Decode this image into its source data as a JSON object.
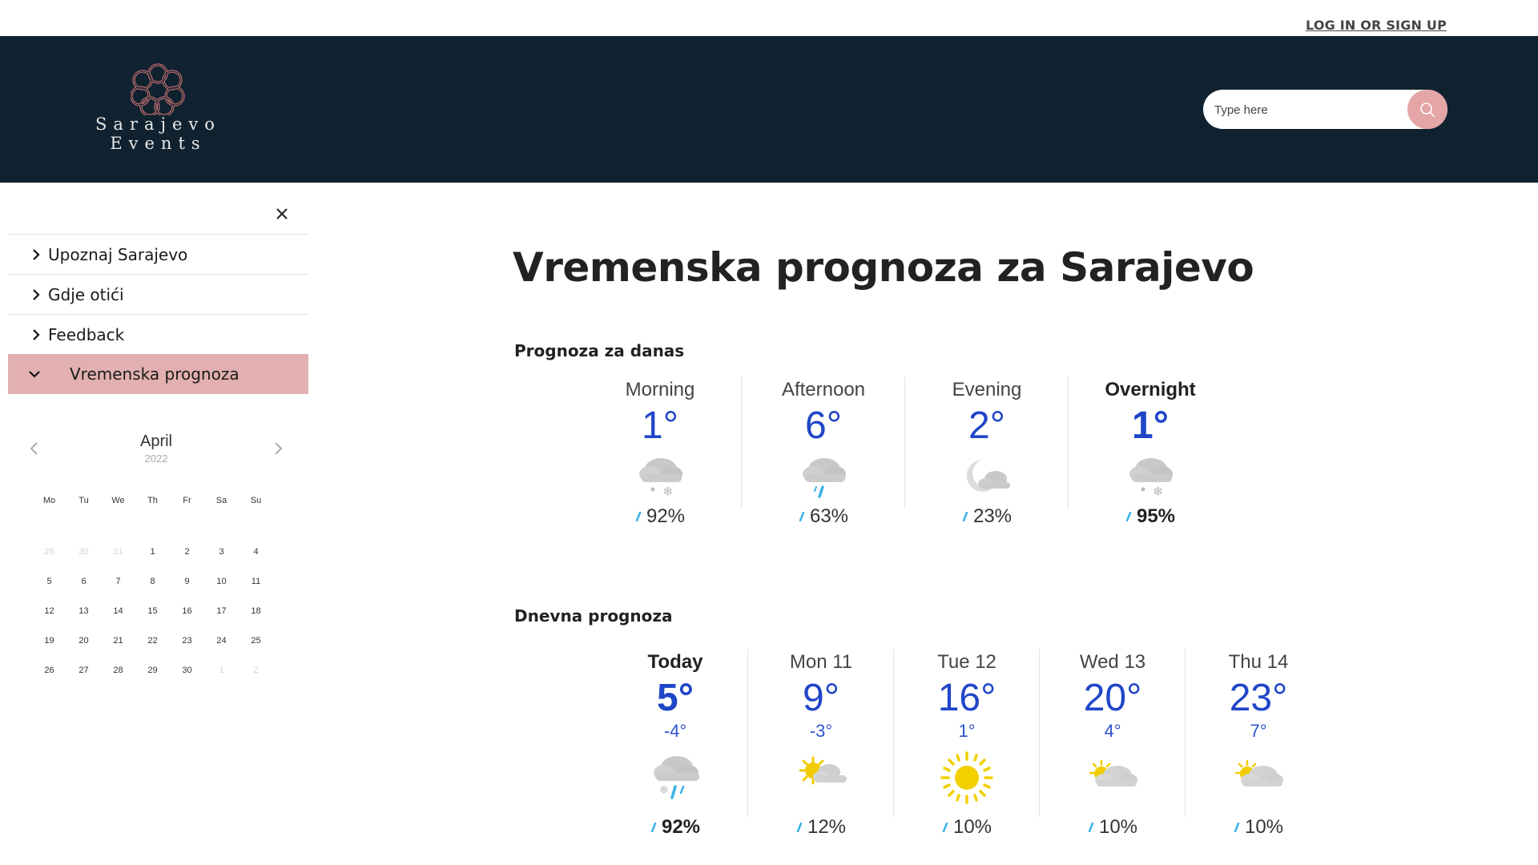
{
  "topbar": {
    "login_label": "LOG IN OR SIGN UP"
  },
  "brand": {
    "line1": "Sarajevo",
    "line2": "Events"
  },
  "search": {
    "placeholder": "Type here"
  },
  "sidebar": {
    "items": [
      {
        "label": "Upoznaj Sarajevo"
      },
      {
        "label": "Gdje otići"
      },
      {
        "label": "Feedback"
      },
      {
        "label": "Vremenska prognoza"
      }
    ]
  },
  "calendar": {
    "month": "April",
    "year": "2022",
    "weekdays": [
      "Mo",
      "Tu",
      "We",
      "Th",
      "Fr",
      "Sa",
      "Su"
    ],
    "weeks": [
      [
        "29",
        "30",
        "31",
        "1",
        "2",
        "3",
        "4"
      ],
      [
        "5",
        "6",
        "7",
        "8",
        "9",
        "10",
        "11"
      ],
      [
        "12",
        "13",
        "14",
        "15",
        "16",
        "17",
        "18"
      ],
      [
        "19",
        "20",
        "21",
        "22",
        "23",
        "24",
        "25"
      ],
      [
        "26",
        "27",
        "28",
        "29",
        "30",
        "1",
        "2"
      ]
    ]
  },
  "main": {
    "title": "Vremenska prognoza za Sarajevo",
    "today_section": "Prognoza za danas",
    "daily_section": "Dnevna prognoza"
  },
  "today": [
    {
      "label": "Morning",
      "temp": "1°",
      "precip": "92%",
      "icon": "snow-cloud-icon"
    },
    {
      "label": "Afternoon",
      "temp": "6°",
      "precip": "63%",
      "icon": "rain-cloud-icon"
    },
    {
      "label": "Evening",
      "temp": "2°",
      "precip": "23%",
      "icon": "moon-cloud-icon"
    },
    {
      "label": "Overnight",
      "temp": "1°",
      "precip": "95%",
      "icon": "snow-cloud-icon"
    }
  ],
  "daily": [
    {
      "label": "Today",
      "high": "5°",
      "low": "-4°",
      "precip": "92%",
      "icon": "sleet-cloud-icon"
    },
    {
      "label": "Mon 11",
      "high": "9°",
      "low": "-3°",
      "precip": "12%",
      "icon": "partly-sunny-icon"
    },
    {
      "label": "Tue 12",
      "high": "16°",
      "low": "1°",
      "precip": "10%",
      "icon": "sun-icon"
    },
    {
      "label": "Wed 13",
      "high": "20°",
      "low": "4°",
      "precip": "10%",
      "icon": "mostly-cloudy-sun-icon"
    },
    {
      "label": "Thu 14",
      "high": "23°",
      "low": "7°",
      "precip": "10%",
      "icon": "mostly-cloudy-sun-icon"
    }
  ],
  "colors": {
    "header_bg": "#10222f",
    "accent": "#e3a5a5",
    "temp_blue": "#2046c8",
    "active_menu": "#e2b0b0"
  }
}
